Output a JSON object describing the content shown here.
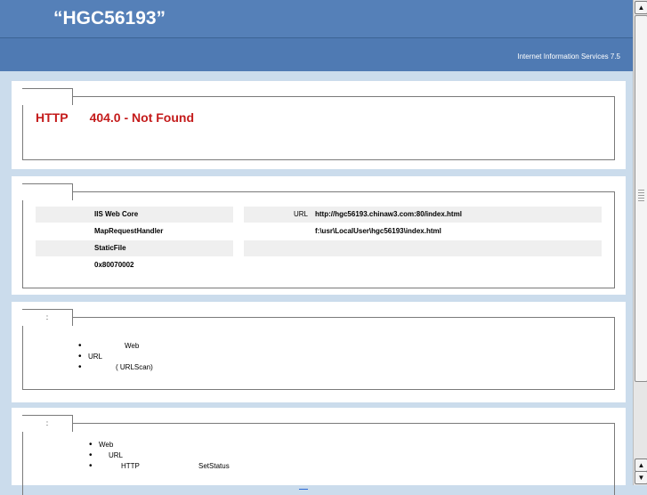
{
  "header": {
    "title": "“HGC56193”",
    "version": "Internet Information Services 7.5"
  },
  "error_panel": {
    "legend": "",
    "prefix": "HTTP",
    "code": "404.0 - Not Found"
  },
  "details_panel": {
    "legend": "",
    "left_column": [
      "IIS Web Core",
      "MapRequestHandler",
      "StaticFile",
      "0x80070002"
    ],
    "url_label": "URL",
    "url_value": "http://hgc56193.chinaw3.com:80/index.html",
    "physical_path": "f:\\usr\\LocalUser\\hgc56193\\index.html"
  },
  "causes_panel": {
    "legend": ":",
    "items": [
      "Web",
      "URL",
      "( URLScan)"
    ]
  },
  "actions_panel": {
    "legend": ":",
    "items": [
      "Web",
      "URL",
      "HTTP",
      "SetStatus"
    ]
  },
  "icons": {
    "bullet": "•",
    "scroll_up": "up-arrow-icon",
    "scroll_down": "down-arrow-icon"
  },
  "colors": {
    "header_bg": "#5580b8",
    "page_bg": "#cbdcec",
    "error_red": "#c41b1b"
  }
}
